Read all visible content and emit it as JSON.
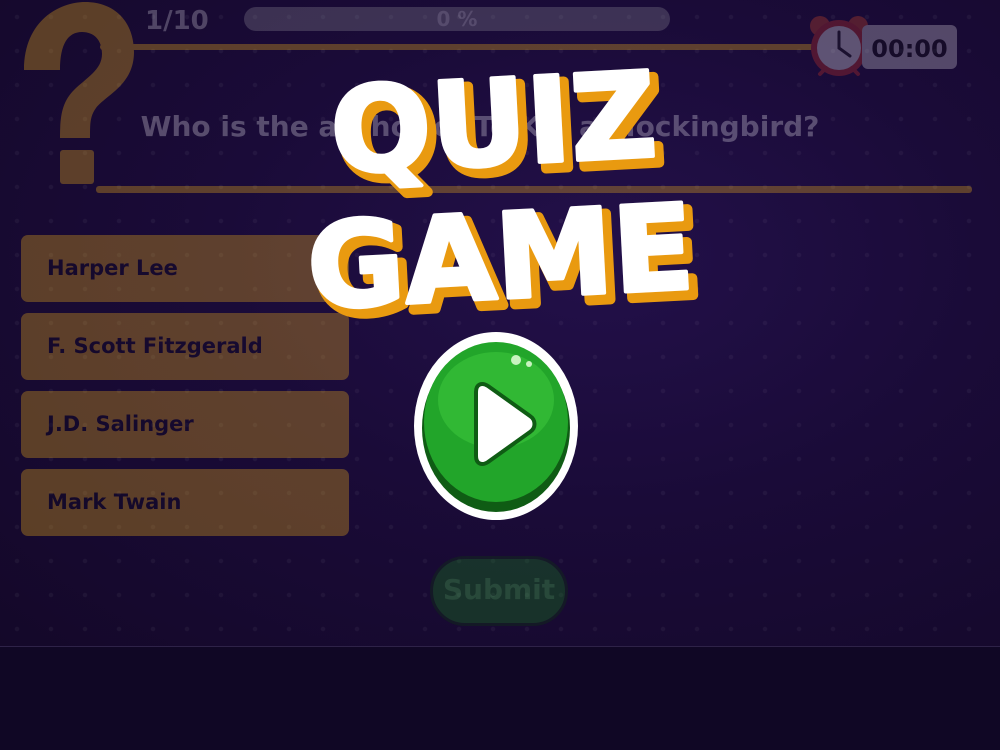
{
  "hud": {
    "counter": "1/10",
    "progress_text": "0 %",
    "progress_value": 0,
    "timer": "00:00"
  },
  "question": {
    "text": "Who is the author of To Kill a Mockingbird?"
  },
  "answers": [
    {
      "label": "Harper Lee"
    },
    {
      "label": "F. Scott Fitzgerald"
    },
    {
      "label": "J.D. Salinger"
    },
    {
      "label": "Mark Twain"
    }
  ],
  "submit_label": "Submit",
  "overlay": {
    "title_line1": "QUIZ",
    "title_line2": "GAME"
  },
  "colors": {
    "accent": "#f2b21c",
    "play_green": "#22a52a",
    "background": "#1a0b38"
  },
  "icons": {
    "question_mark": "question-mark-icon",
    "alarm_clock": "alarm-clock-icon",
    "play": "play-icon"
  }
}
